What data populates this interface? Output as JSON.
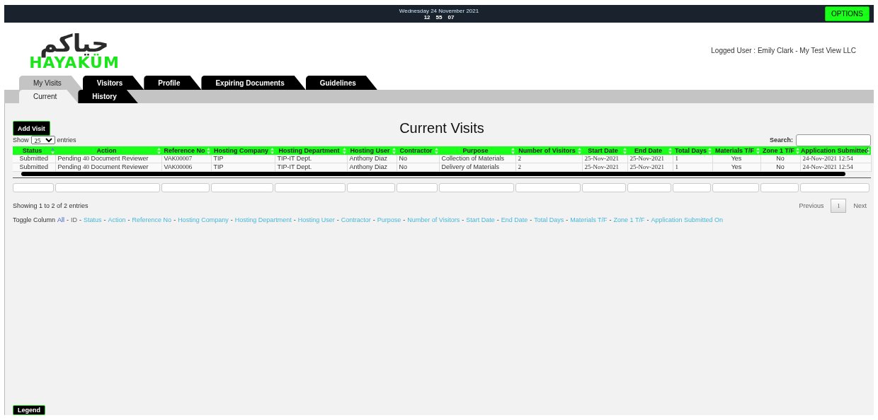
{
  "top_bar": {
    "date": "Wednesday 24 November 2021",
    "time": [
      "12",
      "55",
      "07"
    ],
    "options_button": "OPTIONS"
  },
  "logo": {
    "arabic": "حياكم",
    "latin": "HAYAKÜM"
  },
  "logged_user": "Logged User : Emily Clark - My Test View LLC",
  "tabs": [
    {
      "label": "My Visits",
      "selected": true
    },
    {
      "label": "Visitors",
      "selected": false
    },
    {
      "label": "Profile",
      "selected": false
    },
    {
      "label": "Expiring Documents",
      "selected": false
    },
    {
      "label": "Guidelines",
      "selected": false
    }
  ],
  "sub_tabs": [
    {
      "label": "Current",
      "selected": true
    },
    {
      "label": "History",
      "selected": false
    }
  ],
  "add_button": "Add Visit",
  "title": "Current Visits",
  "length_menu": {
    "before": "Show",
    "value": "25",
    "after": "entries"
  },
  "search": {
    "label": "Search:"
  },
  "table": {
    "columns": [
      {
        "label": "Status",
        "sorted": true
      },
      {
        "label": "Action",
        "sorted": false
      },
      {
        "label": "Reference No",
        "sorted": false
      },
      {
        "label": "Hosting Company",
        "sorted": false
      },
      {
        "label": "Hosting Department",
        "sorted": false
      },
      {
        "label": "Hosting User",
        "sorted": false
      },
      {
        "label": "Contractor",
        "sorted": false
      },
      {
        "label": "Purpose",
        "sorted": false
      },
      {
        "label": "Number of Visitors",
        "sorted": false
      },
      {
        "label": "Start Date",
        "sorted": false
      },
      {
        "label": "End Date",
        "sorted": false
      },
      {
        "label": "Total Days",
        "sorted": false
      },
      {
        "label": "Materials T/F",
        "sorted": false
      },
      {
        "label": "Zone 1 T/F",
        "sorted": false
      },
      {
        "label": "Application Submitted",
        "sorted": false
      }
    ],
    "rows": [
      [
        "Submitted",
        "Pending 40 Document Reviewer",
        "VAK00007",
        "TIP",
        "TIP-IT Dept.",
        "Anthony Diaz",
        "No",
        "Collection of Materials",
        "2",
        "25-Nov-2021",
        "25-Nov-2021",
        "1",
        "Yes",
        "No",
        "24-Nov-2021 12:54"
      ],
      [
        "Submitted",
        "Pending 40 Document Reviewer",
        "VAK00006",
        "TIP",
        "TIP-IT Dept.",
        "Anthony Diaz",
        "No",
        "Delivery of Materials",
        "2",
        "25-Nov-2021",
        "25-Nov-2021",
        "1",
        "Yes",
        "No",
        "24-Nov-2021 12:54"
      ]
    ]
  },
  "info": "Showing 1 to 2 of 2 entries",
  "pagination": {
    "previous": "Previous",
    "pages": [
      {
        "label": "1",
        "selected": true
      }
    ],
    "next": "Next"
  },
  "toggle_columns": {
    "label": "Toggle Column",
    "separator": "-",
    "items": [
      {
        "label": "All",
        "kind": "all"
      },
      {
        "label": "ID",
        "kind": "column",
        "visible": false
      },
      {
        "label": "Status",
        "kind": "column",
        "visible": true
      },
      {
        "label": "Action",
        "kind": "column",
        "visible": true
      },
      {
        "label": "Reference No",
        "kind": "column",
        "visible": true
      },
      {
        "label": "Hosting Company",
        "kind": "column",
        "visible": true
      },
      {
        "label": "Hosting Department",
        "kind": "column",
        "visible": true
      },
      {
        "label": "Hosting User",
        "kind": "column",
        "visible": true
      },
      {
        "label": "Contractor",
        "kind": "column",
        "visible": true
      },
      {
        "label": "Purpose",
        "kind": "column",
        "visible": true
      },
      {
        "label": "Number of Visitors",
        "kind": "column",
        "visible": true
      },
      {
        "label": "Start Date",
        "kind": "column",
        "visible": true
      },
      {
        "label": "End Date",
        "kind": "column",
        "visible": true
      },
      {
        "label": "Total Days",
        "kind": "column",
        "visible": true
      },
      {
        "label": "Materials T/F",
        "kind": "column",
        "visible": true
      },
      {
        "label": "Zone 1 T/F",
        "kind": "column",
        "visible": true
      },
      {
        "label": "Application Submitted On",
        "kind": "column",
        "visible": true
      }
    ]
  },
  "legend_button": "Legend"
}
